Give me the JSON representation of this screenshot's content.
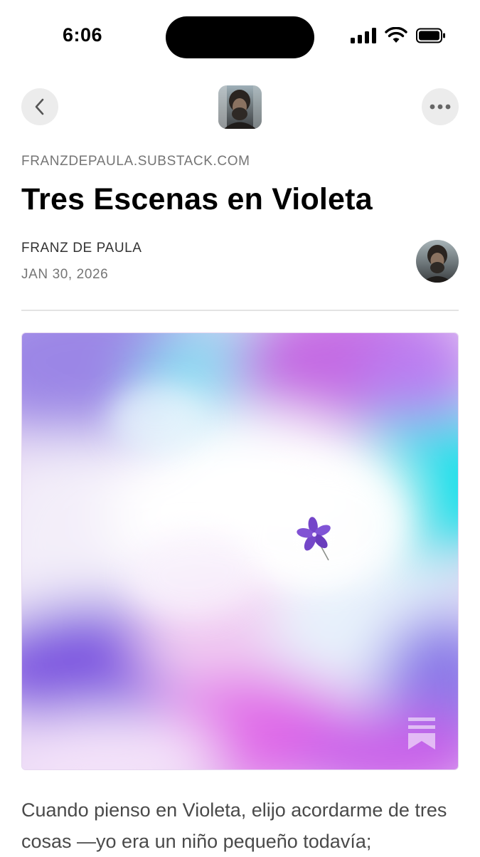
{
  "status_bar": {
    "time": "6:06",
    "icons": [
      "signal-icon",
      "wifi-icon",
      "battery-icon"
    ]
  },
  "nav": {
    "back_icon": "chevron-left-icon",
    "more_icon": "ellipsis-icon"
  },
  "post": {
    "domain": "FRANZDEPAULA.SUBSTACK.COM",
    "title": "Tres Escenas en Violeta",
    "author": "FRANZ DE PAULA",
    "date": "JAN 30, 2026",
    "body_preview": "Cuando pienso en Violeta, elijo acordarme de tres cosas —yo era un niño pequeño todavía;"
  },
  "colors": {
    "nav_button_bg": "#ececec",
    "divider": "#e3e3e3",
    "title": "#000000",
    "meta": "#757575",
    "body": "#4a4a4a"
  }
}
